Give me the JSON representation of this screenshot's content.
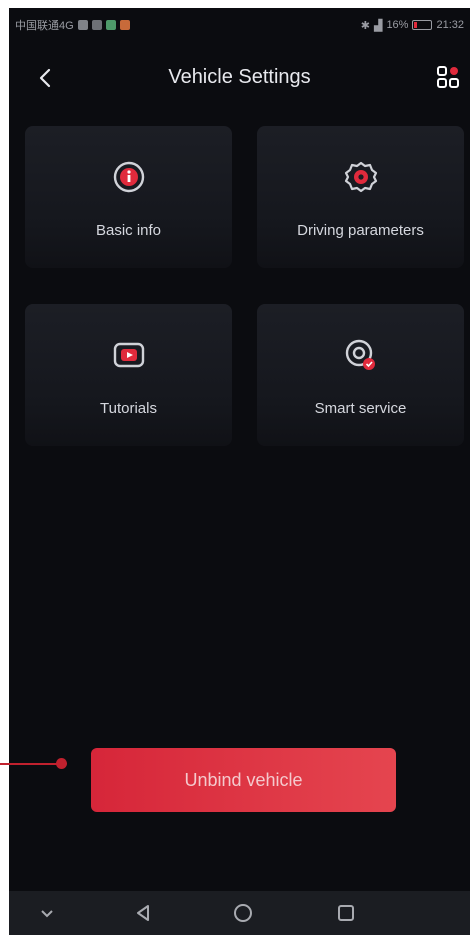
{
  "status_bar": {
    "carrier": "中国联通4G",
    "battery": "16%",
    "time": "21:32"
  },
  "header": {
    "title": "Vehicle Settings"
  },
  "tiles": [
    {
      "label": "Basic info",
      "icon": "info-circle-icon"
    },
    {
      "label": "Driving parameters",
      "icon": "gear-icon"
    },
    {
      "label": "Tutorials",
      "icon": "play-video-icon"
    },
    {
      "label": "Smart service",
      "icon": "smart-service-icon"
    }
  ],
  "actions": {
    "unbind_label": "Unbind vehicle"
  },
  "colors": {
    "accent": "#e02a3c",
    "background": "#0b0c10",
    "tile": "#1a1c22"
  }
}
